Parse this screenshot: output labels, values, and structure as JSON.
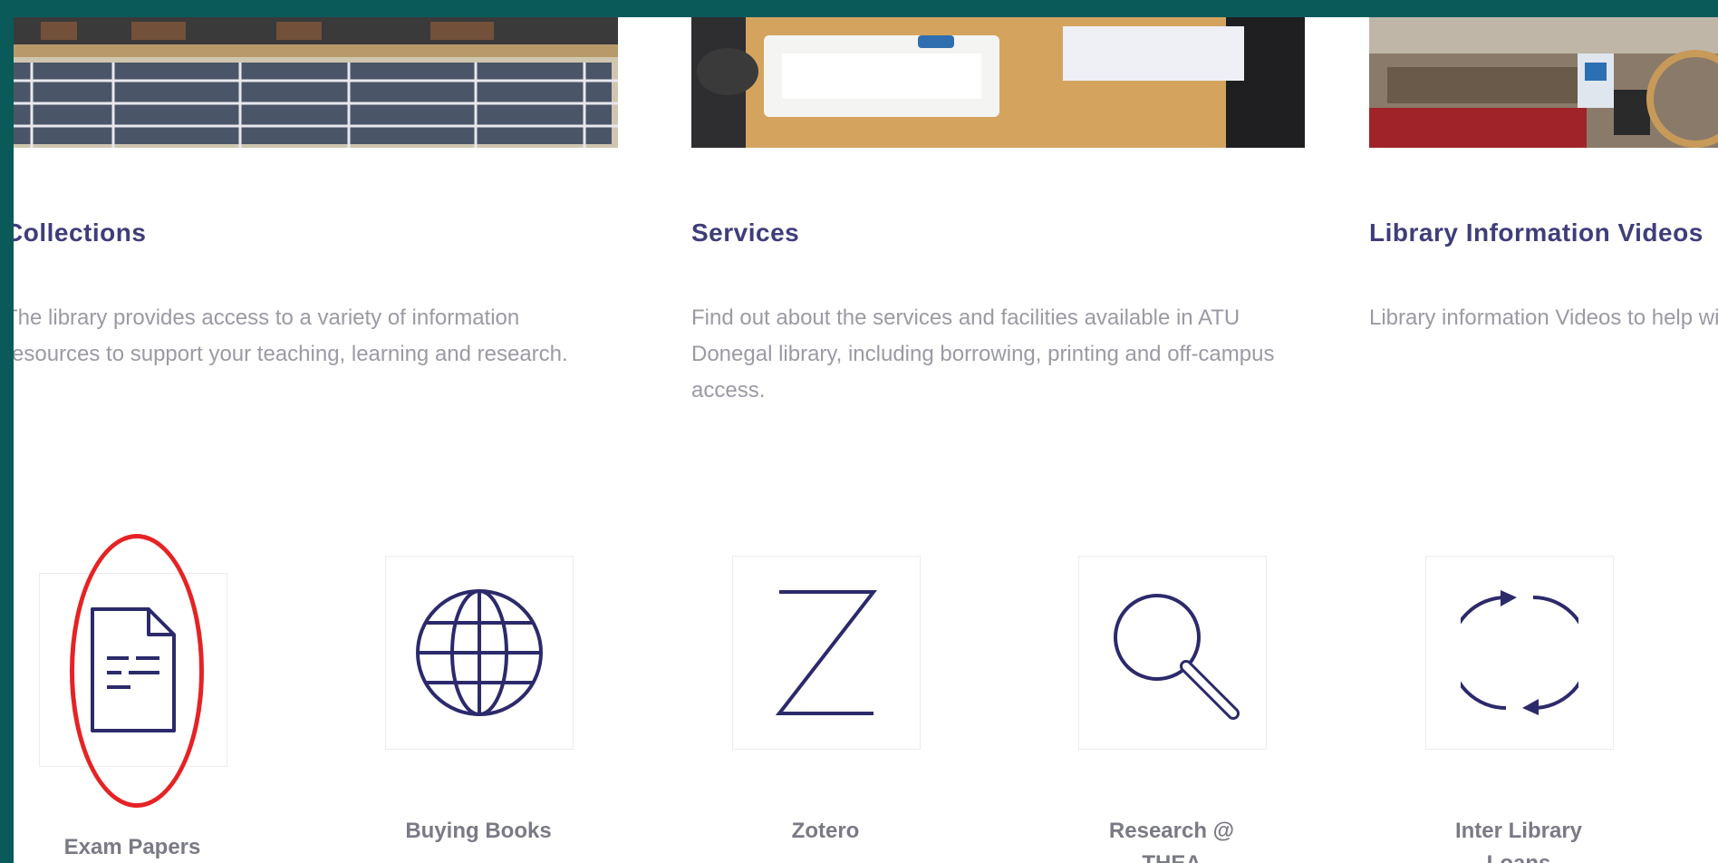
{
  "cards": [
    {
      "title": "Collections",
      "text": "The library provides access to a variety of information resources to support your teaching, learning and research."
    },
    {
      "title": "Services",
      "text": "Find out about the services and facilities available in ATU Donegal library, including borrowing, printing and off-campus access."
    },
    {
      "title": "Library Information Videos",
      "text": "Library information Videos to help with learning and research."
    }
  ],
  "tiles": [
    {
      "label": "Exam Papers",
      "icon": "document-icon"
    },
    {
      "label": "Buying Books",
      "icon": "globe-icon"
    },
    {
      "label": "Zotero",
      "icon": "zotero-z-icon"
    },
    {
      "label": "Research @ THEA",
      "icon": "magnifier-icon"
    },
    {
      "label": "Inter Library Loans",
      "icon": "refresh-cycle-icon"
    }
  ],
  "colors": {
    "frame": "#0b5a5a",
    "accent": "#3f3d7a",
    "icon": "#2c2a6b",
    "highlight": "#e52324"
  }
}
